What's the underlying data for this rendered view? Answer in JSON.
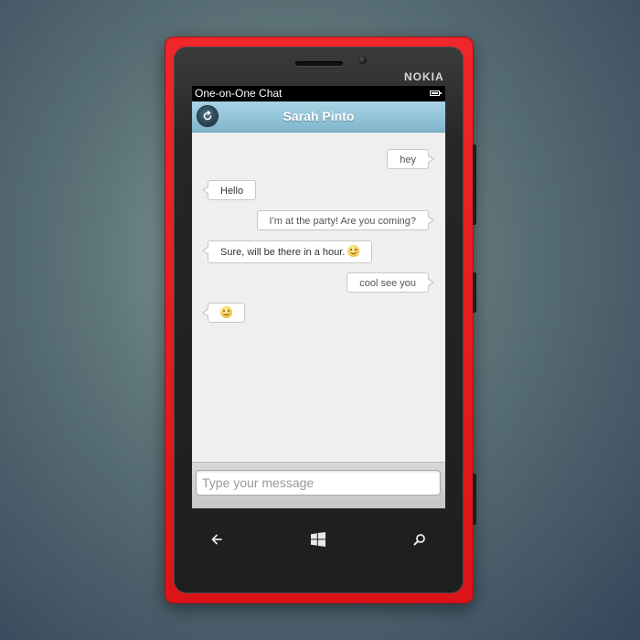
{
  "device": {
    "brand": "NOKIA"
  },
  "status_bar": {
    "app_title": "One-on-One Chat",
    "battery": "battery-icon"
  },
  "header": {
    "title": "Sarah Pinto",
    "back_icon": "back-icon"
  },
  "messages": [
    {
      "direction": "out",
      "text": "hey",
      "emoji": false
    },
    {
      "direction": "in",
      "text": "Hello",
      "emoji": false
    },
    {
      "direction": "out",
      "text": "I'm at the party! Are you coming?",
      "emoji": false
    },
    {
      "direction": "in",
      "text": "Sure, will be there in a hour.",
      "emoji": true
    },
    {
      "direction": "out",
      "text": "cool see you",
      "emoji": false
    },
    {
      "direction": "in",
      "text": "",
      "emoji": true
    }
  ],
  "composer": {
    "placeholder": "Type your message"
  },
  "nav": {
    "back": "arrow-left-icon",
    "home": "windows-icon",
    "search": "search-icon"
  },
  "colors": {
    "phone": "#e21a1e",
    "header": "#8fc1d6",
    "screen": "#efefef"
  }
}
